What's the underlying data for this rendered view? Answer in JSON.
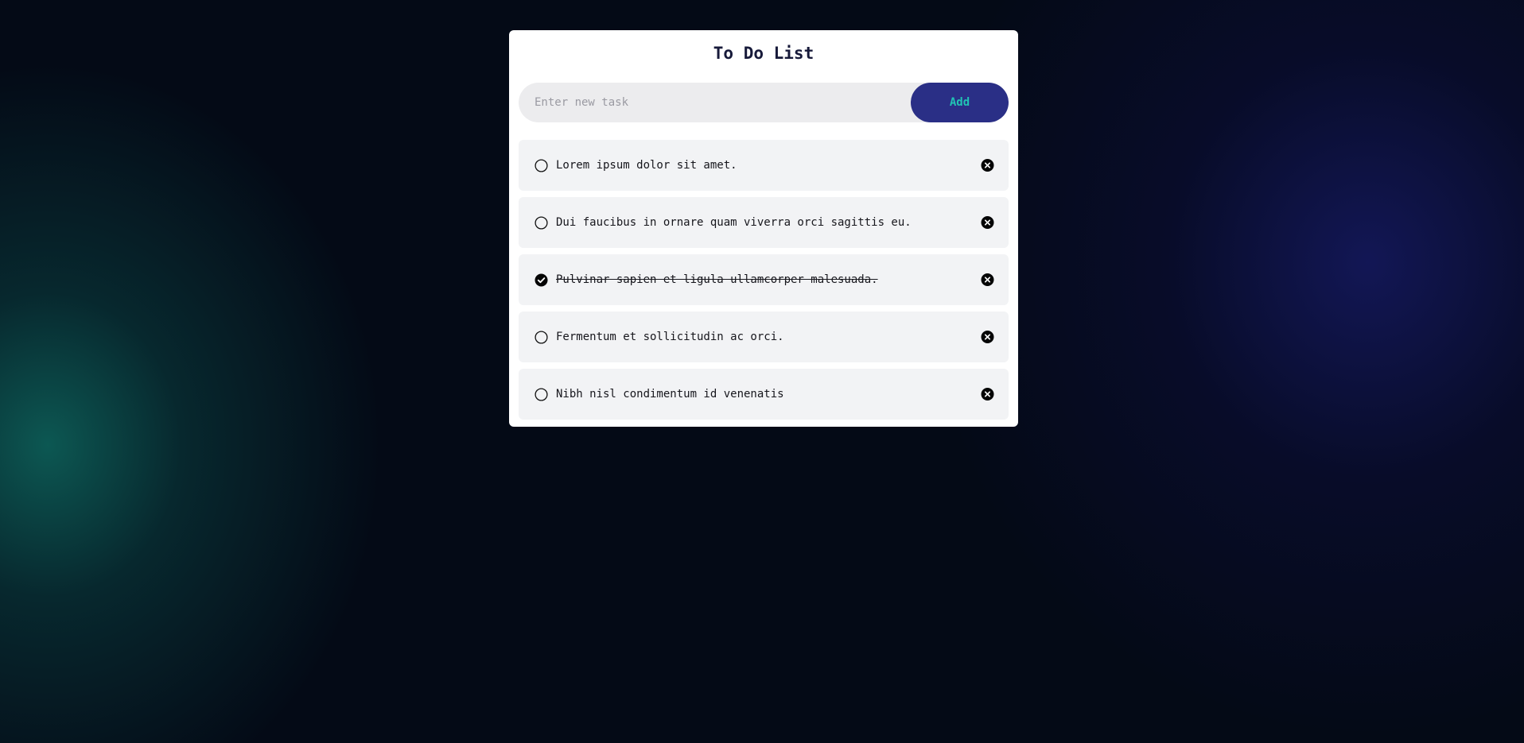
{
  "app": {
    "title": "To Do List"
  },
  "new_task": {
    "placeholder": "Enter new task",
    "value": "",
    "add_label": "Add"
  },
  "tasks": [
    {
      "text": "Lorem ipsum dolor sit amet.",
      "done": false
    },
    {
      "text": "Dui faucibus in ornare quam viverra orci sagittis eu.",
      "done": false
    },
    {
      "text": "Pulvinar sapien et ligula ullamcorper malesuada.",
      "done": true
    },
    {
      "text": "Fermentum et sollicitudin ac orci.",
      "done": false
    },
    {
      "text": "Nibh nisl condimentum id venenatis",
      "done": false
    }
  ],
  "icons": {
    "unchecked": "circle-outline-icon",
    "checked": "check-circle-icon",
    "delete": "close-circle-icon"
  },
  "colors": {
    "accent": "#2a2f86",
    "accent_text": "#21c4b4",
    "title": "#171a3a"
  }
}
